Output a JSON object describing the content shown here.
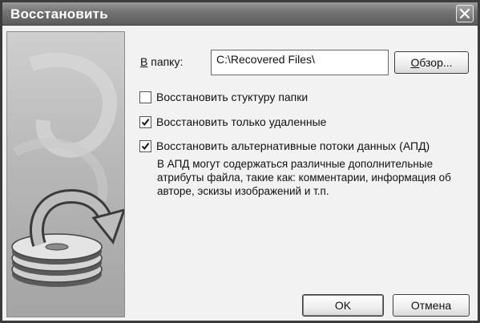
{
  "window": {
    "title": "Восстановить"
  },
  "folder": {
    "label_accel": "В",
    "label_rest": " папку:",
    "value": "C:\\Recovered Files\\",
    "browse_accel": "О",
    "browse_rest": "бзор..."
  },
  "options": [
    {
      "label": "Восстановить стуктуру папки",
      "checked": false
    },
    {
      "label": "Восстановить только удаленные",
      "checked": true
    },
    {
      "label": "Восстановить альтернативные потоки данных (АПД)",
      "checked": true
    }
  ],
  "description": "В АПД могут содержаться различные дополнительные атрибуты файла, такие как: комментарии, информация об авторе, эскизы изображений и т.п.",
  "buttons": {
    "ok": "OK",
    "cancel": "Отмена"
  },
  "colors": {
    "titlebar": "#6e6e6e",
    "dialog_bg": "#f2f2f2"
  },
  "icons": {
    "close": "close-icon",
    "side": "disk-restore-icon",
    "check": "checkmark-icon"
  }
}
